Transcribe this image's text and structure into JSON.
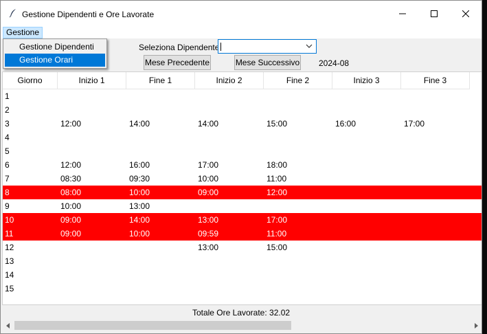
{
  "window": {
    "title": "Gestione Dipendenti e Ore Lavorate"
  },
  "menu": {
    "gestione": "Gestione",
    "items": [
      "Gestione Dipendenti",
      "Gestione Orari"
    ]
  },
  "toolbar": {
    "select_label": "Seleziona Dipendente",
    "select_value": "",
    "prev_label": "Mese Precedente",
    "next_label": "Mese Successivo",
    "month": "2024-08"
  },
  "table": {
    "headers": [
      "Giorno",
      "Inizio 1",
      "Fine 1",
      "Inizio 2",
      "Fine 2",
      "Inizio 3",
      "Fine 3"
    ],
    "rows": [
      {
        "cells": [
          "1",
          "",
          "",
          "",
          "",
          "",
          ""
        ],
        "highlight": false
      },
      {
        "cells": [
          "2",
          "",
          "",
          "",
          "",
          "",
          ""
        ],
        "highlight": false
      },
      {
        "cells": [
          "3",
          "12:00",
          "14:00",
          "14:00",
          "15:00",
          "16:00",
          "17:00"
        ],
        "highlight": false
      },
      {
        "cells": [
          "4",
          "",
          "",
          "",
          "",
          "",
          ""
        ],
        "highlight": false
      },
      {
        "cells": [
          "5",
          "",
          "",
          "",
          "",
          "",
          ""
        ],
        "highlight": false
      },
      {
        "cells": [
          "6",
          "12:00",
          "16:00",
          "17:00",
          "18:00",
          "",
          ""
        ],
        "highlight": false
      },
      {
        "cells": [
          "7",
          "08:30",
          "09:30",
          "10:00",
          "11:00",
          "",
          ""
        ],
        "highlight": false
      },
      {
        "cells": [
          "8",
          "08:00",
          "10:00",
          "09:00",
          "12:00",
          "",
          ""
        ],
        "highlight": true
      },
      {
        "cells": [
          "9",
          "10:00",
          "13:00",
          "",
          "",
          "",
          ""
        ],
        "highlight": false
      },
      {
        "cells": [
          "10",
          "09:00",
          "14:00",
          "13:00",
          "17:00",
          "",
          ""
        ],
        "highlight": true
      },
      {
        "cells": [
          "11",
          "09:00",
          "10:00",
          "09:59",
          "11:00",
          "",
          ""
        ],
        "highlight": true
      },
      {
        "cells": [
          "12",
          "",
          "",
          "13:00",
          "15:00",
          "",
          ""
        ],
        "highlight": false
      },
      {
        "cells": [
          "13",
          "",
          "",
          "",
          "",
          "",
          ""
        ],
        "highlight": false
      },
      {
        "cells": [
          "14",
          "",
          "",
          "",
          "",
          "",
          ""
        ],
        "highlight": false
      },
      {
        "cells": [
          "15",
          "",
          "",
          "",
          "",
          "",
          ""
        ],
        "highlight": false
      }
    ]
  },
  "footer": {
    "total": "Totale Ore Lavorate: 32.02"
  },
  "icons": {
    "app": "feather-icon",
    "minimize": "minimize-icon",
    "maximize": "maximize-icon",
    "close": "close-icon",
    "dropdown": "chevron-down-icon",
    "scroll_left": "arrow-left-icon",
    "scroll_right": "arrow-right-icon"
  },
  "colors": {
    "highlight_row": "#ff0000",
    "menu_selected": "#0078d7",
    "accent_border": "#0078d7"
  }
}
